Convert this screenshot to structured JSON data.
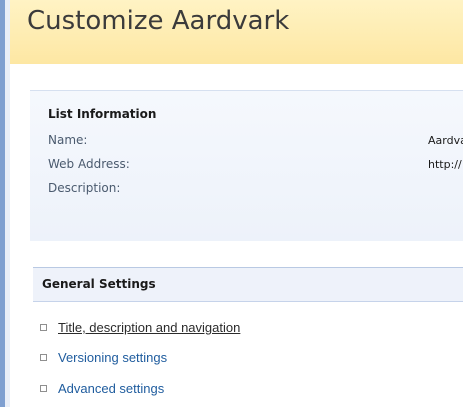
{
  "page": {
    "title": "Customize Aardvark"
  },
  "list_information": {
    "heading": "List Information",
    "rows": [
      {
        "label": "Name:",
        "value": "Aardvark"
      },
      {
        "label": "Web Address:",
        "value": "http://"
      },
      {
        "label": "Description:",
        "value": ""
      }
    ]
  },
  "general_settings": {
    "heading": "General Settings",
    "links": [
      {
        "label": "Title, description and navigation"
      },
      {
        "label": "Versioning settings"
      },
      {
        "label": "Advanced settings"
      }
    ]
  },
  "colors": {
    "title_band": "#fde7a3",
    "link": "#1f5c9e",
    "left_bar": "#7f9fd0"
  }
}
